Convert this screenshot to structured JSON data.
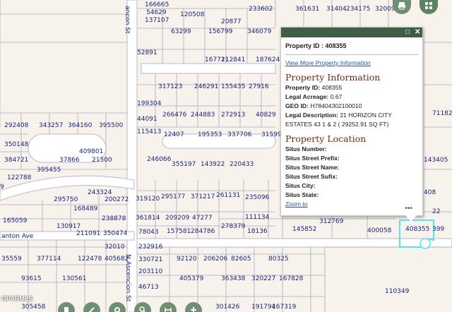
{
  "popup": {
    "property_id_line": "Property ID : 408355",
    "view_more_link": "View More Property Information",
    "info_heading": "Property Information",
    "info_rows": [
      {
        "label": "Property ID:",
        "value": "408355"
      },
      {
        "label": "Legal Acreage:",
        "value": "0.67"
      },
      {
        "label": "GEO ID:",
        "value": "H78404302100010"
      },
      {
        "label": "Legal Description:",
        "value": "21 HORIZON CITY ESTATES 43 1 & 2 ( 29252.91 SQ FT)"
      }
    ],
    "location_heading": "Property Location",
    "location_rows": [
      {
        "label": "Situs Number:",
        "value": ""
      },
      {
        "label": "Situs Street Prefix:",
        "value": ""
      },
      {
        "label": "Situs Street Name:",
        "value": ""
      },
      {
        "label": "Situs Street Sufix:",
        "value": ""
      },
      {
        "label": "Situs City:",
        "value": ""
      },
      {
        "label": "Situs State:",
        "value": ""
      }
    ],
    "zoom_link": "Zoom to",
    "more_icon": "ellipsis-icon",
    "maximize_icon": "maximize-icon",
    "close_icon": "close-icon"
  },
  "toolbar": {
    "top": [
      {
        "icon": "print-icon"
      },
      {
        "icon": "grid-apps-icon"
      }
    ],
    "bottom": [
      {
        "icon": "bookmark-icon"
      },
      {
        "icon": "draw-icon"
      },
      {
        "icon": "measure-icon"
      },
      {
        "icon": "search-icon"
      },
      {
        "icon": "distance-icon"
      },
      {
        "icon": "add-icon"
      }
    ]
  },
  "map": {
    "streets": [
      "ancon St",
      "anton Ave",
      "N Ascencion St"
    ],
    "selected_parcel": "408355",
    "credit": "GPARMLS",
    "colors": {
      "parcel_line": "#a9a9bb",
      "label": "#1a237e",
      "selection": "#5ce1f2",
      "popup_header": "#3f5f45",
      "heading": "#7a1f0f"
    },
    "parcels": [
      "166665",
      "54629",
      "137107",
      "120508",
      "20877",
      "233602",
      "361631",
      "31404",
      "234175",
      "320098",
      "63299",
      "156799",
      "346079",
      "52891",
      "167711",
      "212841",
      "187624",
      "317123",
      "246291",
      "155435",
      "27916",
      "199304",
      "266476",
      "244883",
      "272913",
      "40829",
      "44091",
      "115413",
      "12407",
      "195353",
      "337706",
      "31599",
      "292408",
      "343257",
      "364160",
      "395500",
      "350148",
      "409801",
      "384721",
      "37866",
      "21500",
      "395455",
      "246066",
      "355197",
      "143922",
      "220433",
      "122788",
      "243324",
      "295750",
      "200272",
      "168489",
      "238878",
      "130917",
      "211091",
      "350474",
      "319120",
      "295177",
      "371217",
      "261131",
      "235096",
      "361814",
      "209209",
      "47277",
      "111134",
      "157581",
      "284786",
      "278379",
      "18136",
      "78043",
      "232916",
      "32010",
      "35559",
      "377114",
      "122478",
      "405682",
      "93615",
      "130561",
      "92120",
      "206206",
      "82605",
      "80325",
      "405379",
      "363438",
      "320227",
      "167828",
      "330721",
      "203110",
      "46713",
      "305458",
      "301426",
      "191794",
      "167319",
      "110349",
      "145852",
      "312769",
      "400058",
      "408355",
      "399",
      "71182",
      "143405",
      "408",
      "165059",
      "9",
      "22"
    ]
  }
}
